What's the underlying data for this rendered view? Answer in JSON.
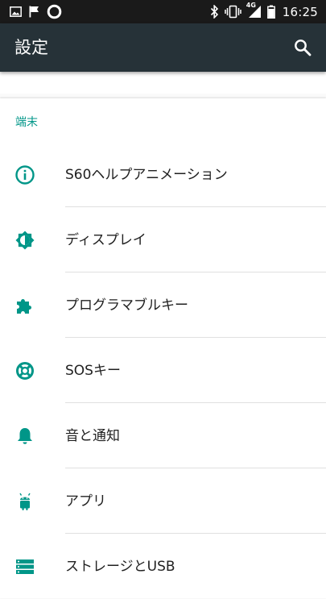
{
  "status_bar": {
    "time": "16:25",
    "network_label": "4G",
    "left_icons": [
      "image-icon",
      "flag-icon",
      "circle-icon"
    ],
    "right_icons": [
      "bluetooth-icon",
      "vibrate-icon",
      "signal-icon",
      "battery-icon"
    ]
  },
  "app_bar": {
    "title": "設定",
    "search_icon": "search-icon"
  },
  "section": {
    "header": "端末"
  },
  "items": [
    {
      "label": "S60ヘルプアニメーション",
      "icon": "info-icon"
    },
    {
      "label": "ディスプレイ",
      "icon": "brightness-icon"
    },
    {
      "label": "プログラマブルキー",
      "icon": "puzzle-icon"
    },
    {
      "label": "SOSキー",
      "icon": "lifebuoy-icon"
    },
    {
      "label": "音と通知",
      "icon": "bell-icon"
    },
    {
      "label": "アプリ",
      "icon": "android-icon"
    },
    {
      "label": "ストレージとUSB",
      "icon": "storage-icon"
    }
  ],
  "colors": {
    "status_bar": "#1a1a1a",
    "app_bar": "#263238",
    "accent": "#009688",
    "text_primary": "#212121",
    "divider": "#e0e0e0"
  }
}
